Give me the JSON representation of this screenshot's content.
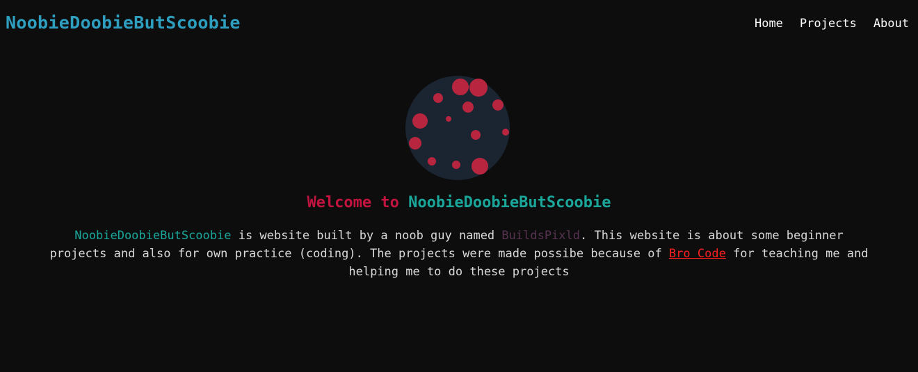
{
  "colors": {
    "background": "#0d0d0e",
    "brand": "#2f9fc0",
    "teal": "#1aa79a",
    "crimson": "#c2143f",
    "purple": "#56324f",
    "link_red": "#ff1f1f",
    "planet_body": "#1b2532",
    "planet_spots": "#b8253f"
  },
  "header": {
    "brand": "NoobieDoobieButScoobie",
    "nav": [
      {
        "label": "Home"
      },
      {
        "label": "Projects"
      },
      {
        "label": "About"
      }
    ]
  },
  "hero": {
    "logo_icon": "spotted-planet-icon",
    "headline_prefix": "Welcome to ",
    "headline_name": "NoobieDoobieButScoobie",
    "intro": {
      "site_name": "NoobieDoobieButScoobie",
      "text_1": " is website built by a noob guy named ",
      "author": "BuildsPixld",
      "text_2": ". This website is about some beginner projects and also for own practice (coding). The projects were made possibe because of ",
      "link_text": "Bro Code",
      "text_3": " for teaching me and helping me to do these projects"
    }
  }
}
